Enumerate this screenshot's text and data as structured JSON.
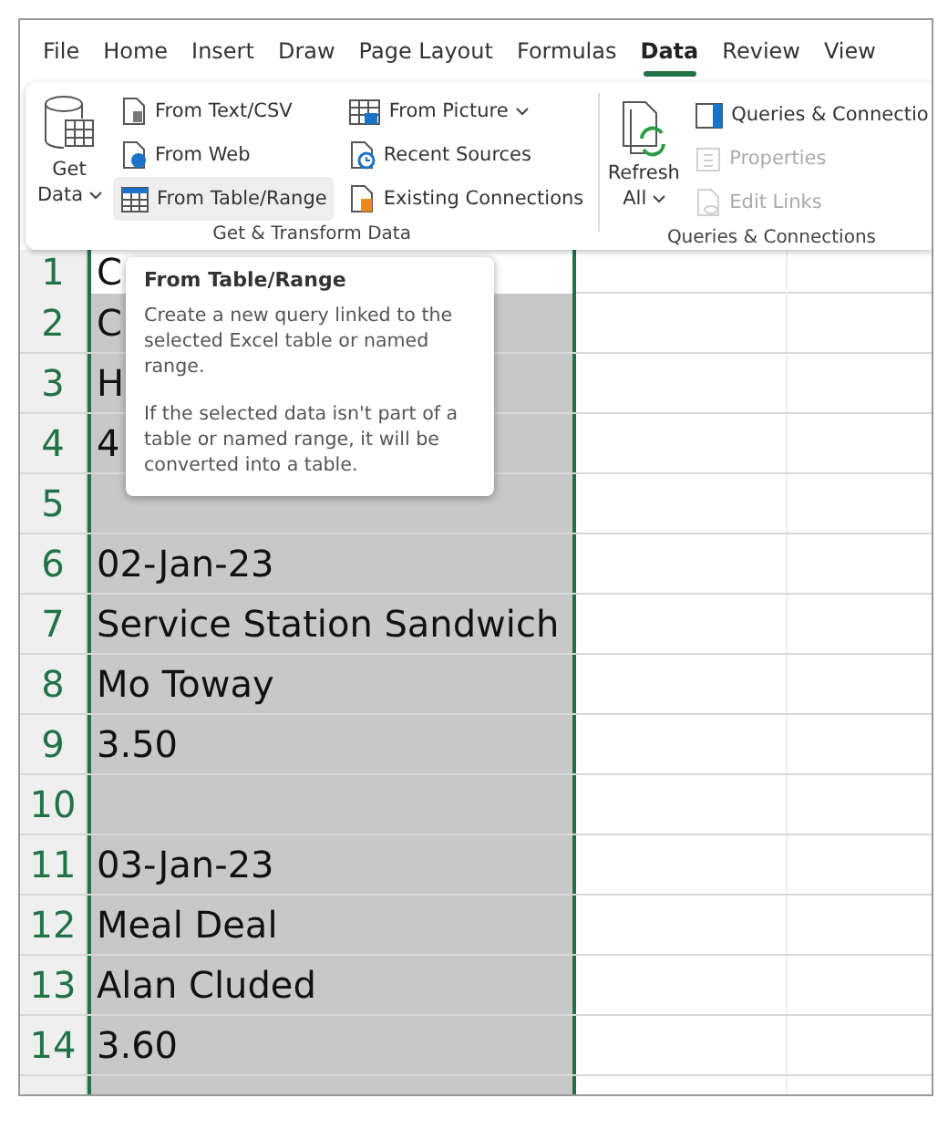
{
  "menu_tabs": [
    {
      "label": "File",
      "selected": false
    },
    {
      "label": "Home",
      "selected": false
    },
    {
      "label": "Insert",
      "selected": false
    },
    {
      "label": "Draw",
      "selected": false
    },
    {
      "label": "Page Layout",
      "selected": false
    },
    {
      "label": "Formulas",
      "selected": false
    },
    {
      "label": "Data",
      "selected": true
    },
    {
      "label": "Review",
      "selected": false
    },
    {
      "label": "View",
      "selected": false
    }
  ],
  "ribbon": {
    "groups": [
      {
        "label": "Get & Transform Data",
        "big_button": {
          "lines": [
            "Get",
            "Data"
          ],
          "dropdown": true
        },
        "columns": [
          [
            {
              "label": "From Text/CSV",
              "disabled": false,
              "dropdown": false,
              "hovered": false
            },
            {
              "label": "From Web",
              "disabled": false,
              "dropdown": false,
              "hovered": false
            },
            {
              "label": "From Table/Range",
              "disabled": false,
              "dropdown": false,
              "hovered": true
            }
          ],
          [
            {
              "label": "From Picture",
              "disabled": false,
              "dropdown": true,
              "hovered": false
            },
            {
              "label": "Recent Sources",
              "disabled": false,
              "dropdown": false,
              "hovered": false
            },
            {
              "label": "Existing Connections",
              "disabled": false,
              "dropdown": false,
              "hovered": false
            }
          ]
        ]
      },
      {
        "label": "Queries & Connections",
        "big_button": {
          "lines": [
            "Refresh",
            "All"
          ],
          "dropdown": true
        },
        "columns": [
          [
            {
              "label": "Queries & Connectio",
              "disabled": false,
              "dropdown": false,
              "hovered": false
            },
            {
              "label": "Properties",
              "disabled": true,
              "dropdown": false,
              "hovered": false
            },
            {
              "label": "Edit Links",
              "disabled": true,
              "dropdown": false,
              "hovered": false
            }
          ]
        ]
      }
    ]
  },
  "sheet": {
    "rows": [
      {
        "number": "1",
        "value": "C",
        "active": true,
        "selected": true
      },
      {
        "number": "2",
        "value": "C",
        "active": false,
        "selected": true
      },
      {
        "number": "3",
        "value": "H",
        "active": false,
        "selected": true
      },
      {
        "number": "4",
        "value": "4",
        "active": false,
        "selected": true
      },
      {
        "number": "5",
        "value": "",
        "active": false,
        "selected": true
      },
      {
        "number": "6",
        "value": "02-Jan-23",
        "active": false,
        "selected": true
      },
      {
        "number": "7",
        "value": "Service Station Sandwich",
        "active": false,
        "selected": true
      },
      {
        "number": "8",
        "value": "Mo Toway",
        "active": false,
        "selected": true
      },
      {
        "number": "9",
        "value": "3.50",
        "active": false,
        "selected": true
      },
      {
        "number": "10",
        "value": "",
        "active": false,
        "selected": true
      },
      {
        "number": "11",
        "value": "03-Jan-23",
        "active": false,
        "selected": true
      },
      {
        "number": "12",
        "value": "Meal Deal",
        "active": false,
        "selected": true
      },
      {
        "number": "13",
        "value": "Alan Cluded",
        "active": false,
        "selected": true
      },
      {
        "number": "14",
        "value": "3.60",
        "active": false,
        "selected": true
      },
      {
        "number": "",
        "value": "",
        "active": false,
        "selected": true
      }
    ]
  },
  "tooltip": {
    "title": "From Table/Range",
    "paragraphs": [
      "Create a new query linked to the selected Excel table or named range.",
      "If the selected data isn't part of a table or named range, it will be converted into a table."
    ]
  }
}
